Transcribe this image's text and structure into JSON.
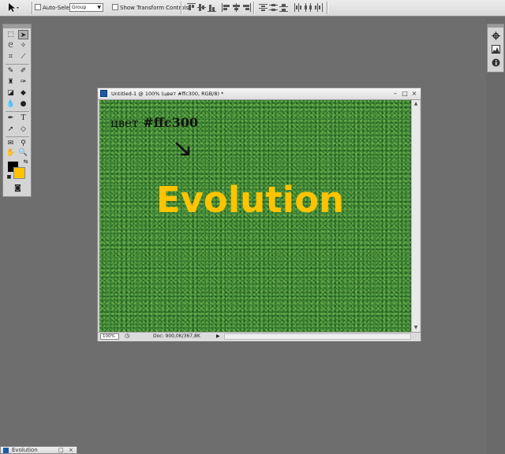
{
  "options_bar": {
    "auto_select_label": "Auto-Select:",
    "auto_select_value": "Group",
    "show_transform_label": "Show Transform Controls"
  },
  "document": {
    "title": "Untitled-1 @ 100% (цвет #ffc300, RGB/8) *",
    "note_text": "цвет",
    "note_hex": "#ffc300",
    "main_text": "Evolution",
    "zoom": "100%",
    "doc_size": "Doc: 900,0K/367,8K"
  },
  "minimized_window": {
    "title": "Evolution"
  },
  "colors": {
    "foreground": "#000000",
    "background": "#ffc300",
    "text_accent": "#ffc300"
  },
  "icons": [
    "move-tool-icon",
    "marquee-icon",
    "lasso-icon",
    "crop-icon",
    "heal-icon",
    "brush-icon",
    "stamp-icon",
    "history-brush-icon",
    "eraser-icon",
    "gradient-icon",
    "blur-icon",
    "dodge-icon",
    "pen-icon",
    "type-icon",
    "path-select-icon",
    "shape-icon",
    "notes-icon",
    "eyedropper-icon",
    "hand-icon",
    "zoom-icon",
    "quickmask-icon",
    "navigator-icon",
    "histogram-icon",
    "info-icon"
  ]
}
